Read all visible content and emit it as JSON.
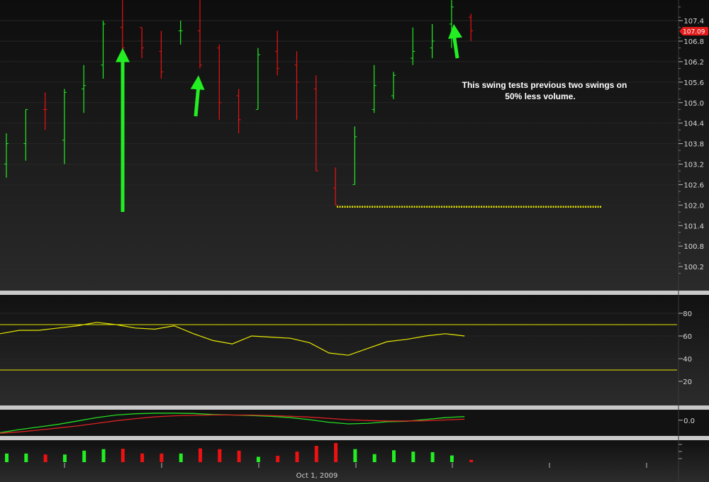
{
  "chart_data": [
    {
      "type": "ohlc",
      "panel": "price",
      "x_count": 25,
      "ylim": [
        99.6,
        107.9
      ],
      "yticks": [
        100.2,
        100.8,
        101.4,
        102.0,
        102.6,
        103.2,
        103.8,
        104.4,
        105.0,
        105.6,
        106.2,
        106.8,
        107.4
      ],
      "ytick_labels": [
        "100.2",
        "100.8",
        "101.4",
        "102.0",
        "102.6",
        "103.2",
        "103.8",
        "104.4",
        "105.0",
        "105.6",
        "106.2",
        "106.8",
        "107.4"
      ],
      "last_price": 107.09,
      "last_price_label": "107.09",
      "bars": [
        {
          "o": 103.2,
          "h": 104.1,
          "l": 102.8,
          "c": 103.8,
          "up": true
        },
        {
          "o": 103.8,
          "h": 104.8,
          "l": 103.3,
          "c": 104.8,
          "up": true
        },
        {
          "o": 104.8,
          "h": 105.3,
          "l": 104.2,
          "c": 104.8,
          "up": false
        },
        {
          "o": 103.9,
          "h": 105.4,
          "l": 103.2,
          "c": 105.3,
          "up": true
        },
        {
          "o": 105.4,
          "h": 106.1,
          "l": 104.7,
          "c": 105.5,
          "up": true
        },
        {
          "o": 106.1,
          "h": 107.4,
          "l": 105.7,
          "c": 107.3,
          "up": true
        },
        {
          "o": 107.2,
          "h": 108.0,
          "l": 106.5,
          "c": 106.6,
          "up": false
        },
        {
          "o": 107.2,
          "h": 107.2,
          "l": 106.3,
          "c": 106.6,
          "up": false
        },
        {
          "o": 106.5,
          "h": 107.1,
          "l": 105.7,
          "c": 105.9,
          "up": false
        },
        {
          "o": 107.1,
          "h": 107.4,
          "l": 106.7,
          "c": 107.1,
          "up": true
        },
        {
          "o": 107.1,
          "h": 108.0,
          "l": 106.0,
          "c": 106.1,
          "up": false
        },
        {
          "o": 106.6,
          "h": 106.7,
          "l": 104.5,
          "c": 105.0,
          "up": false
        },
        {
          "o": 105.2,
          "h": 105.4,
          "l": 104.1,
          "c": 104.5,
          "up": false
        },
        {
          "o": 104.8,
          "h": 106.6,
          "l": 104.8,
          "c": 106.4,
          "up": true
        },
        {
          "o": 106.5,
          "h": 107.1,
          "l": 105.8,
          "c": 106.0,
          "up": false
        },
        {
          "o": 106.1,
          "h": 106.5,
          "l": 104.5,
          "c": 105.6,
          "up": false
        },
        {
          "o": 105.4,
          "h": 105.8,
          "l": 103.0,
          "c": 103.0,
          "up": false
        },
        {
          "o": 102.5,
          "h": 103.1,
          "l": 102.0,
          "c": 102.0,
          "up": false
        },
        {
          "o": 102.6,
          "h": 104.3,
          "l": 102.6,
          "c": 104.0,
          "up": true
        },
        {
          "o": 104.8,
          "h": 106.1,
          "l": 104.7,
          "c": 105.5,
          "up": true
        },
        {
          "o": 105.2,
          "h": 105.9,
          "l": 105.1,
          "c": 105.8,
          "up": true
        },
        {
          "o": 106.3,
          "h": 107.2,
          "l": 106.1,
          "c": 106.5,
          "up": true
        },
        {
          "o": 106.6,
          "h": 107.3,
          "l": 106.3,
          "c": 106.8,
          "up": true
        },
        {
          "o": 107.3,
          "h": 108.0,
          "l": 106.6,
          "c": 107.8,
          "up": true
        },
        {
          "o": 107.5,
          "h": 107.6,
          "l": 106.8,
          "c": 107.1,
          "up": false
        }
      ],
      "support_level": 101.95,
      "annotations": [
        {
          "text": "This swing tests previous two swings on",
          "text2": "50% less volume."
        }
      ],
      "arrows": [
        {
          "bar": 6,
          "from_price": 101.8,
          "to_price": 106.6
        },
        {
          "bar": 10,
          "from_price": 104.6,
          "to_price": 105.8
        },
        {
          "bar": 23,
          "from_price": 106.3,
          "to_price": 107.3
        }
      ]
    },
    {
      "type": "line",
      "panel": "oscillator",
      "ylim": [
        0,
        95
      ],
      "yticks": [
        20,
        40,
        60,
        80
      ],
      "ytick_labels": [
        "20",
        "40",
        "60",
        "80"
      ],
      "levels": [
        70,
        30
      ],
      "values": [
        62,
        65,
        65,
        67,
        69,
        72,
        70,
        67,
        66,
        69,
        62,
        56,
        53,
        60,
        59,
        58,
        54,
        45,
        43,
        49,
        55,
        57,
        60,
        62,
        60
      ]
    },
    {
      "type": "line",
      "panel": "macd",
      "ylim": [
        -0.55,
        0.35
      ],
      "yticks": [
        0.0
      ],
      "ytick_labels": [
        "0.0"
      ],
      "series": [
        {
          "values": [
            -0.48,
            -0.36,
            -0.26,
            -0.16,
            -0.03,
            0.1,
            0.2,
            0.25,
            0.27,
            0.27,
            0.26,
            0.22,
            0.2,
            0.18,
            0.15,
            0.1,
            0.02,
            -0.08,
            -0.14,
            -0.12,
            -0.06,
            -0.04,
            0.03,
            0.1,
            0.14
          ],
          "color": "#22dd22"
        },
        {
          "values": [
            -0.5,
            -0.45,
            -0.38,
            -0.3,
            -0.22,
            -0.12,
            -0.02,
            0.06,
            0.13,
            0.17,
            0.19,
            0.2,
            0.2,
            0.2,
            0.18,
            0.15,
            0.12,
            0.07,
            0.02,
            -0.01,
            -0.03,
            -0.03,
            -0.02,
            0.01,
            0.04
          ],
          "color": "#dd2222"
        }
      ]
    },
    {
      "type": "bar",
      "panel": "volume",
      "values": [
        0.45,
        0.45,
        0.4,
        0.4,
        0.6,
        0.68,
        0.7,
        0.45,
        0.45,
        0.45,
        0.72,
        0.68,
        0.6,
        0.28,
        0.33,
        0.55,
        0.85,
        1.0,
        0.68,
        0.42,
        0.62,
        0.55,
        0.52,
        0.35,
        0.12
      ],
      "colors": [
        "#22ee22",
        "#22ee22",
        "#ee1111",
        "#22ee22",
        "#22ee22",
        "#22ee22",
        "#ee1111",
        "#ee1111",
        "#ee1111",
        "#22ee22",
        "#ee1111",
        "#ee1111",
        "#ee1111",
        "#22ee22",
        "#ee1111",
        "#ee1111",
        "#ee1111",
        "#ee1111",
        "#22ee22",
        "#22ee22",
        "#22ee22",
        "#22ee22",
        "#22ee22",
        "#22ee22",
        "#ee1111"
      ]
    }
  ],
  "x_axis": {
    "date_label": "Oct 1, 2009"
  },
  "colors": {
    "up": "#22ee22",
    "down": "#ee1111",
    "level_line": "#e8e800",
    "arrow": "#22ee22",
    "price_tag": "#e31b1b"
  }
}
